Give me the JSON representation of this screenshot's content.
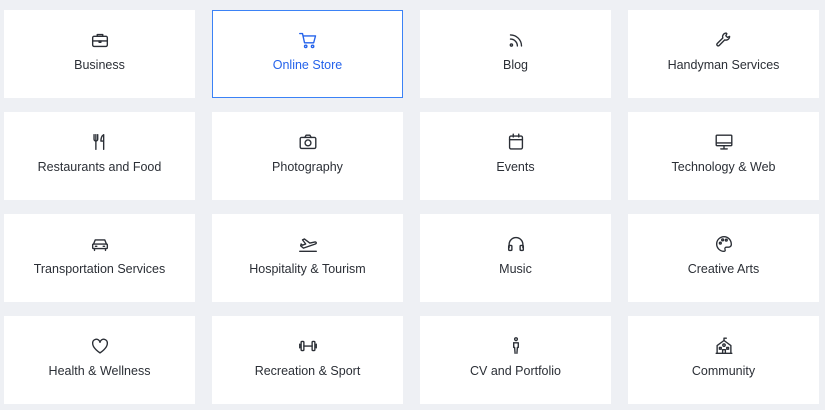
{
  "accent_color": "#3b82f6",
  "selected_tile": "Online Store",
  "tiles": [
    {
      "label": "Business",
      "icon": "briefcase-icon"
    },
    {
      "label": "Online Store",
      "icon": "shopping-cart-icon"
    },
    {
      "label": "Blog",
      "icon": "rss-icon"
    },
    {
      "label": "Handyman Services",
      "icon": "wrench-icon"
    },
    {
      "label": "Restaurants and Food",
      "icon": "fork-knife-icon"
    },
    {
      "label": "Photography",
      "icon": "camera-icon"
    },
    {
      "label": "Events",
      "icon": "calendar-icon"
    },
    {
      "label": "Technology & Web",
      "icon": "monitor-icon"
    },
    {
      "label": "Transportation Services",
      "icon": "car-icon"
    },
    {
      "label": "Hospitality & Tourism",
      "icon": "airplane-icon"
    },
    {
      "label": "Music",
      "icon": "headphones-icon"
    },
    {
      "label": "Creative Arts",
      "icon": "palette-icon"
    },
    {
      "label": "Health & Wellness",
      "icon": "heart-icon"
    },
    {
      "label": "Recreation & Sport",
      "icon": "dumbbell-icon"
    },
    {
      "label": "CV and Portfolio",
      "icon": "person-icon"
    },
    {
      "label": "Community",
      "icon": "community-building-icon"
    }
  ]
}
